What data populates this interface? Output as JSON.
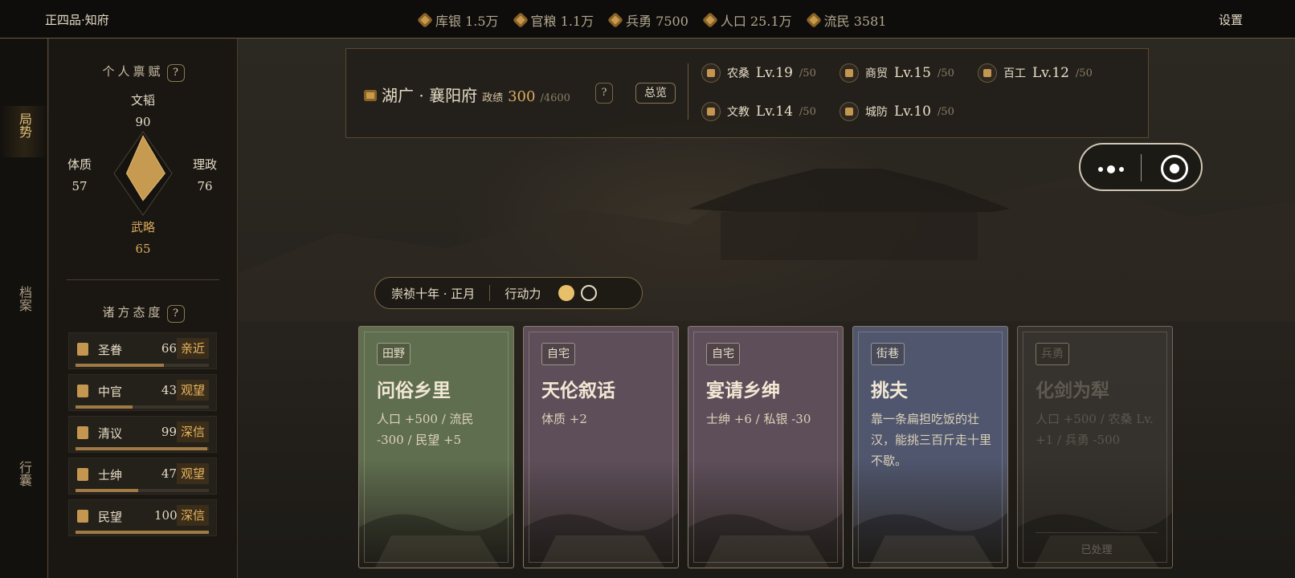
{
  "header": {
    "rank": "正四品·知府",
    "settings_label": "设置",
    "resources": [
      {
        "icon": "silver-icon",
        "label": "库银 1.5万"
      },
      {
        "icon": "grain-icon",
        "label": "官粮 1.1万"
      },
      {
        "icon": "soldier-icon",
        "label": "兵勇 7500"
      },
      {
        "icon": "population-icon",
        "label": "人口 25.1万"
      },
      {
        "icon": "refugee-icon",
        "label": "流民 3581"
      }
    ]
  },
  "nav": {
    "items": [
      {
        "label": "局势",
        "active": true
      },
      {
        "label": "档案",
        "active": false
      },
      {
        "label": "行囊",
        "active": false
      }
    ]
  },
  "talent": {
    "title": "个人禀赋",
    "help": "?",
    "stats": {
      "wen": {
        "label": "文韬",
        "value": "90"
      },
      "tizhi": {
        "label": "体质",
        "value": "57"
      },
      "lizheng": {
        "label": "理政",
        "value": "76"
      },
      "wulue": {
        "label": "武略",
        "value": "65"
      }
    }
  },
  "attitudes": {
    "title": "诸方态度",
    "help": "?",
    "rows": [
      {
        "name": "圣眷",
        "value": "66",
        "tag": "亲近",
        "fill": 0.66
      },
      {
        "name": "中官",
        "value": "43",
        "tag": "观望",
        "fill": 0.43
      },
      {
        "name": "清议",
        "value": "99",
        "tag": "深信",
        "fill": 0.99
      },
      {
        "name": "士绅",
        "value": "47",
        "tag": "观望",
        "fill": 0.47
      },
      {
        "name": "民望",
        "value": "100",
        "tag": "深信",
        "fill": 1.0
      }
    ]
  },
  "region": {
    "name": "湖广 · 襄阳府",
    "perf_label": "政绩",
    "perf_value": "300",
    "perf_max": "/4600",
    "help": "?",
    "overview_label": "总览",
    "buildings": [
      {
        "name": "农桑",
        "level": "Lv.19",
        "max": "/50"
      },
      {
        "name": "商贸",
        "level": "Lv.15",
        "max": "/50"
      },
      {
        "name": "百工",
        "level": "Lv.12",
        "max": "/50"
      },
      {
        "name": "文教",
        "level": "Lv.14",
        "max": "/50"
      },
      {
        "name": "城防",
        "level": "Lv.10",
        "max": "/50"
      }
    ]
  },
  "turn": {
    "date": "崇祯十年 · 正月",
    "action_label": "行动力",
    "action_total": 2,
    "action_left": 1
  },
  "cards": [
    {
      "tag": "田野",
      "title": "问俗乡里",
      "desc": "人口 +500 / 流民 -300 / 民望 +5",
      "theme": "#5f6e4f",
      "done": false
    },
    {
      "tag": "自宅",
      "title": "天伦叙话",
      "desc": "体质 +2",
      "theme": "#5e4e5a",
      "done": false
    },
    {
      "tag": "自宅",
      "title": "宴请乡绅",
      "desc": "士绅 +6 / 私银 -30",
      "theme": "#5e4e5a",
      "done": false
    },
    {
      "tag": "街巷",
      "title": "挑夫",
      "desc": "靠一条扁担吃饭的壮汉，能挑三百斤走十里不歇。",
      "theme": "#4f566e",
      "done": false
    },
    {
      "tag": "兵勇",
      "title": "化剑为犁",
      "desc": "人口 +500 / 农桑 Lv. +1 / 兵勇 -500",
      "theme": "#3b3833",
      "done": true,
      "done_label": "已处理"
    }
  ]
}
